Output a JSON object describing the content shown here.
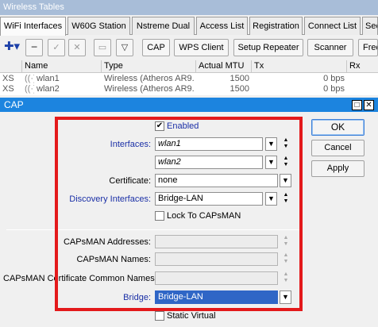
{
  "bg_window": {
    "title": "Wireless Tables",
    "tabs": [
      {
        "label": "WiFi Interfaces",
        "active": true
      },
      {
        "label": "W60G Station"
      },
      {
        "label": "Nstreme Dual"
      },
      {
        "label": "Access List"
      },
      {
        "label": "Registration"
      },
      {
        "label": "Connect List"
      },
      {
        "label": "Sec"
      }
    ],
    "toolbar": {
      "cap_label": "CAP",
      "wps_label": "WPS Client",
      "repeater_label": "Setup Repeater",
      "scanner_label": "Scanner",
      "freq_label": "Freq"
    },
    "grid": {
      "columns": [
        "Name",
        "Type",
        "Actual MTU",
        "Tx",
        "Rx"
      ],
      "rows": [
        {
          "flags": "XS",
          "name": "wlan1",
          "type": "Wireless (Atheros AR9...",
          "mtu": "1500",
          "tx": "0 bps"
        },
        {
          "flags": "XS",
          "name": "wlan2",
          "type": "Wireless (Atheros AR9...",
          "mtu": "1500",
          "tx": "0 bps"
        }
      ]
    }
  },
  "cap_dialog": {
    "title": "CAP",
    "enabled_label": "Enabled",
    "enabled_checked": true,
    "interfaces_label": "Interfaces:",
    "interfaces": [
      "wlan1",
      "wlan2"
    ],
    "certificate_label": "Certificate:",
    "certificate_value": "none",
    "discovery_label": "Discovery Interfaces:",
    "discovery_value": "Bridge-LAN",
    "lock_label": "Lock To CAPsMAN",
    "lock_checked": false,
    "capsman_addresses_label": "CAPsMAN Addresses:",
    "capsman_names_label": "CAPsMAN Names:",
    "capsman_cert_label": "CAPsMAN Certificate Common Names:",
    "bridge_label": "Bridge:",
    "bridge_value": "Bridge-LAN",
    "static_virtual_label": "Static Virtual",
    "static_virtual_checked": false,
    "buttons": {
      "ok": "OK",
      "cancel": "Cancel",
      "apply": "Apply"
    },
    "highlight_color": "#e3191b"
  }
}
